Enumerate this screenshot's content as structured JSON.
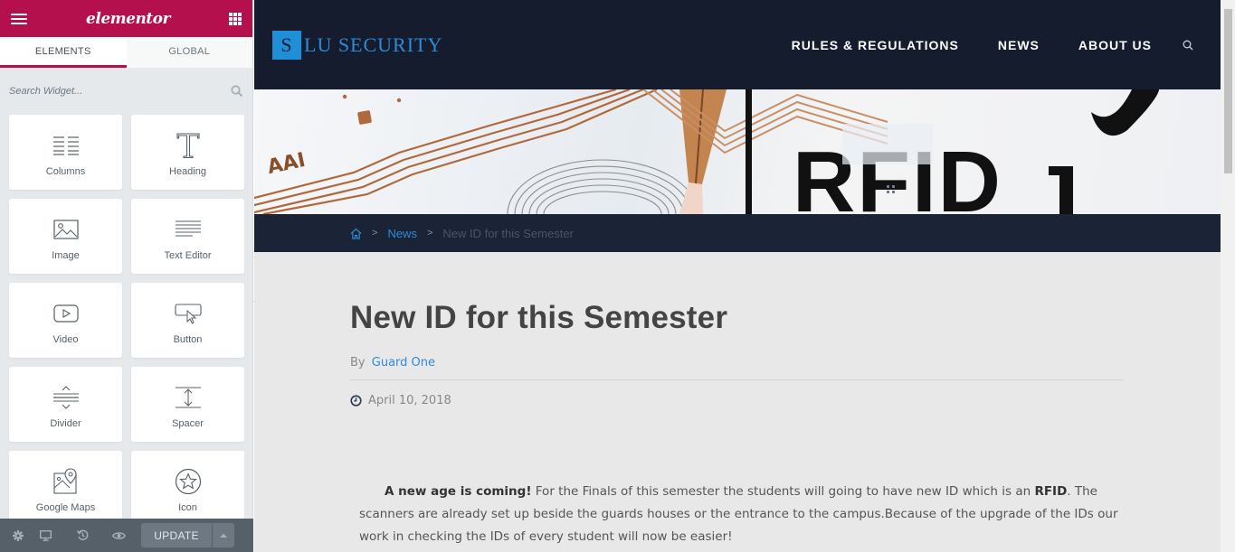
{
  "panel": {
    "brand": "elementor",
    "tabs": [
      {
        "label": "ELEMENTS",
        "active": true
      },
      {
        "label": "GLOBAL",
        "active": false
      }
    ],
    "search_placeholder": "Search Widget...",
    "widgets": [
      {
        "label": "Columns",
        "icon": "columns-icon"
      },
      {
        "label": "Heading",
        "icon": "heading-icon"
      },
      {
        "label": "Image",
        "icon": "image-icon"
      },
      {
        "label": "Text Editor",
        "icon": "text-editor-icon"
      },
      {
        "label": "Video",
        "icon": "video-icon"
      },
      {
        "label": "Button",
        "icon": "button-icon"
      },
      {
        "label": "Divider",
        "icon": "divider-icon"
      },
      {
        "label": "Spacer",
        "icon": "spacer-icon"
      },
      {
        "label": "Google Maps",
        "icon": "google-maps-icon"
      },
      {
        "label": "Icon",
        "icon": "star-icon"
      }
    ],
    "footer": {
      "update_label": "UPDATE"
    },
    "accent_color": "#b5104e"
  },
  "site": {
    "logo_letter": "S",
    "logo_text": "LU SECURITY",
    "nav": [
      "RULES & REGULATIONS",
      "NEWS",
      "ABOUT US"
    ],
    "banner_text": "RFID",
    "banner_card_text": "AAI",
    "breadcrumb": {
      "link": "News",
      "current": "New ID for this Semester"
    },
    "post": {
      "title": "New ID for this Semester",
      "by_label": "By",
      "author": "Guard One",
      "date": "April 10, 2018",
      "lead_bold": "A new age is coming!",
      "text_1": " For the Finals of this semester the students will going to have new ID which is an ",
      "rfid_bold": "RFID",
      "text_2": ".  The scanners are already set up beside the guards houses or the entrance to the campus.Because of the upgrade of the IDs our work in checking the IDs of every student will now be easier!"
    },
    "header_color": "#141c2e",
    "link_color": "#2e8bd6"
  }
}
